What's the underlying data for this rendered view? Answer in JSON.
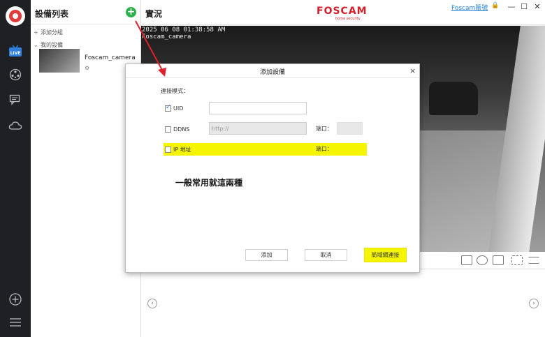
{
  "sidebar": {
    "live_label": "LIVE",
    "rail_icons": [
      "live-icon",
      "playback-icon",
      "message-icon",
      "cloud-icon",
      "add-icon",
      "menu-icon"
    ]
  },
  "device_panel": {
    "title": "設備列表",
    "add_group": "添加分組",
    "my_devices": "我的設備",
    "devices": [
      {
        "name": "Foscam_camera",
        "settings_glyph": "⚙"
      }
    ]
  },
  "topbar": {
    "title": "實況",
    "brand": "FOSCAM",
    "brand_sub": "home security",
    "account": "Foscam賬號",
    "window_buttons": {
      "lock": "🔒",
      "minimize": "—",
      "maximize": "☐",
      "close": "✕"
    }
  },
  "video": {
    "timestamp": "2025 06 08 01:38:58 AM",
    "camera_name": "Foscam_camera"
  },
  "dialog": {
    "title": "添加設備",
    "close": "×",
    "connection_mode_label": "連接模式：",
    "options": [
      {
        "label": "UID",
        "checked": true,
        "value": "",
        "placeholder": ""
      },
      {
        "label": "DDNS",
        "checked": false,
        "value": "",
        "placeholder": "http://"
      },
      {
        "label": "IP 地址",
        "checked": false,
        "value": "",
        "placeholder": ""
      }
    ],
    "port_label": "端口：",
    "buttons": {
      "add": "添加",
      "cancel": "取消",
      "lan_connect": "局域網連接"
    }
  },
  "annotation": {
    "note": "一般常用就這兩種",
    "highlight_color": "#f5f500",
    "arrow_color": "#e0202a"
  },
  "colors": {
    "brand_red": "#d21f2a",
    "add_green": "#2bb24c",
    "link_blue": "#1e7fd8"
  }
}
